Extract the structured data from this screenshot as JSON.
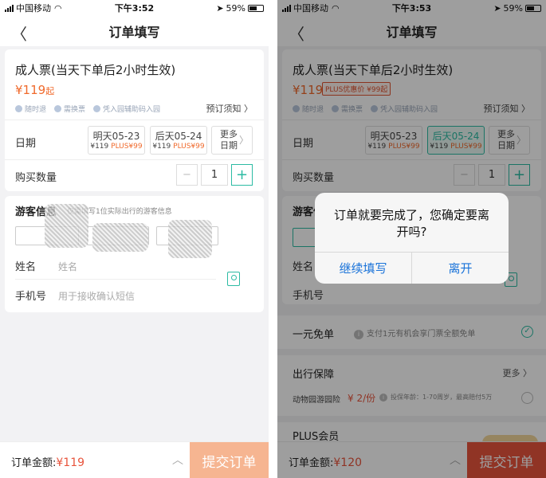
{
  "colors": {
    "accent": "#2cbba3",
    "price": "#f06a2c",
    "submit_disabled": "#f6b591",
    "submit_active": "#e8543c",
    "dialog_button": "#1a73d9"
  },
  "screen1": {
    "status": {
      "carrier": "中国移动",
      "time": "下午3:52",
      "battery": "59%"
    },
    "nav": {
      "title": "订单填写",
      "back_icon": "chevron-left-icon"
    },
    "ticket": {
      "title": "成人票(当天下单后2小时生效)",
      "price": "¥119",
      "price_suffix": "起",
      "features": [
        "随时退",
        "需换票",
        "凭入园辅助码入园"
      ],
      "notice": "预订须知 〉",
      "date_label": "日期",
      "dates": [
        {
          "date": "明天05-23",
          "price": "¥119",
          "plus": "PLUS¥99"
        },
        {
          "date": "后天05-24",
          "price": "¥119",
          "plus": "PLUS¥99"
        }
      ],
      "more": "更多日期",
      "qty_label": "购买数量",
      "qty_minus": "−",
      "qty": "1",
      "qty_plus": "+"
    },
    "visitor": {
      "title": "游客信息",
      "hint": "仅需填写1位实际出行的游客信息",
      "name_label": "姓名",
      "name_placeholder": "姓名",
      "phone_label": "手机号",
      "phone_placeholder": "用于接收确认短信"
    },
    "bottom": {
      "total_label": "订单金额:",
      "total": "¥119",
      "caret": "︿",
      "submit": "提交订单"
    }
  },
  "screen2": {
    "status": {
      "carrier": "中国移动",
      "time": "下午3:53",
      "battery": "59%"
    },
    "nav": {
      "title": "订单填写"
    },
    "ticket": {
      "title": "成人票(当天下单后2小时生效)",
      "price": "¥119",
      "plus_tag": "PLUS优惠价 ¥99起",
      "features": [
        "随时退",
        "需换票",
        "凭入园辅助码入园"
      ],
      "notice": "预订须知 〉",
      "date_label": "日期",
      "dates": [
        {
          "date": "明天05-23",
          "price": "¥119",
          "plus": "PLUS¥99"
        },
        {
          "date": "后天05-24",
          "price": "¥119",
          "plus": "PLUS¥99"
        }
      ],
      "more": "更多日期",
      "qty_label": "购买数量",
      "qty": "1"
    },
    "visitor": {
      "title": "游客信",
      "name_label": "姓名",
      "phone_label": "手机号"
    },
    "free": {
      "title": "一元免单",
      "desc": "支付1元有机会享门票全额免单"
    },
    "insurance": {
      "title": "出行保障",
      "more": "更多 〉",
      "item": "动物园游园险",
      "price": "¥ 2/份",
      "desc": "投保年龄：1-70周岁，最高赔付5万"
    },
    "plus": {
      "title": "PLUS会员"
    },
    "bottom": {
      "total_label": "订单金额:",
      "total": "¥120",
      "caret": "︿",
      "submit": "提交订单"
    },
    "dialog": {
      "message": "订单就要完成了，您确定要离开吗?",
      "continue": "继续填写",
      "leave": "离开"
    }
  }
}
